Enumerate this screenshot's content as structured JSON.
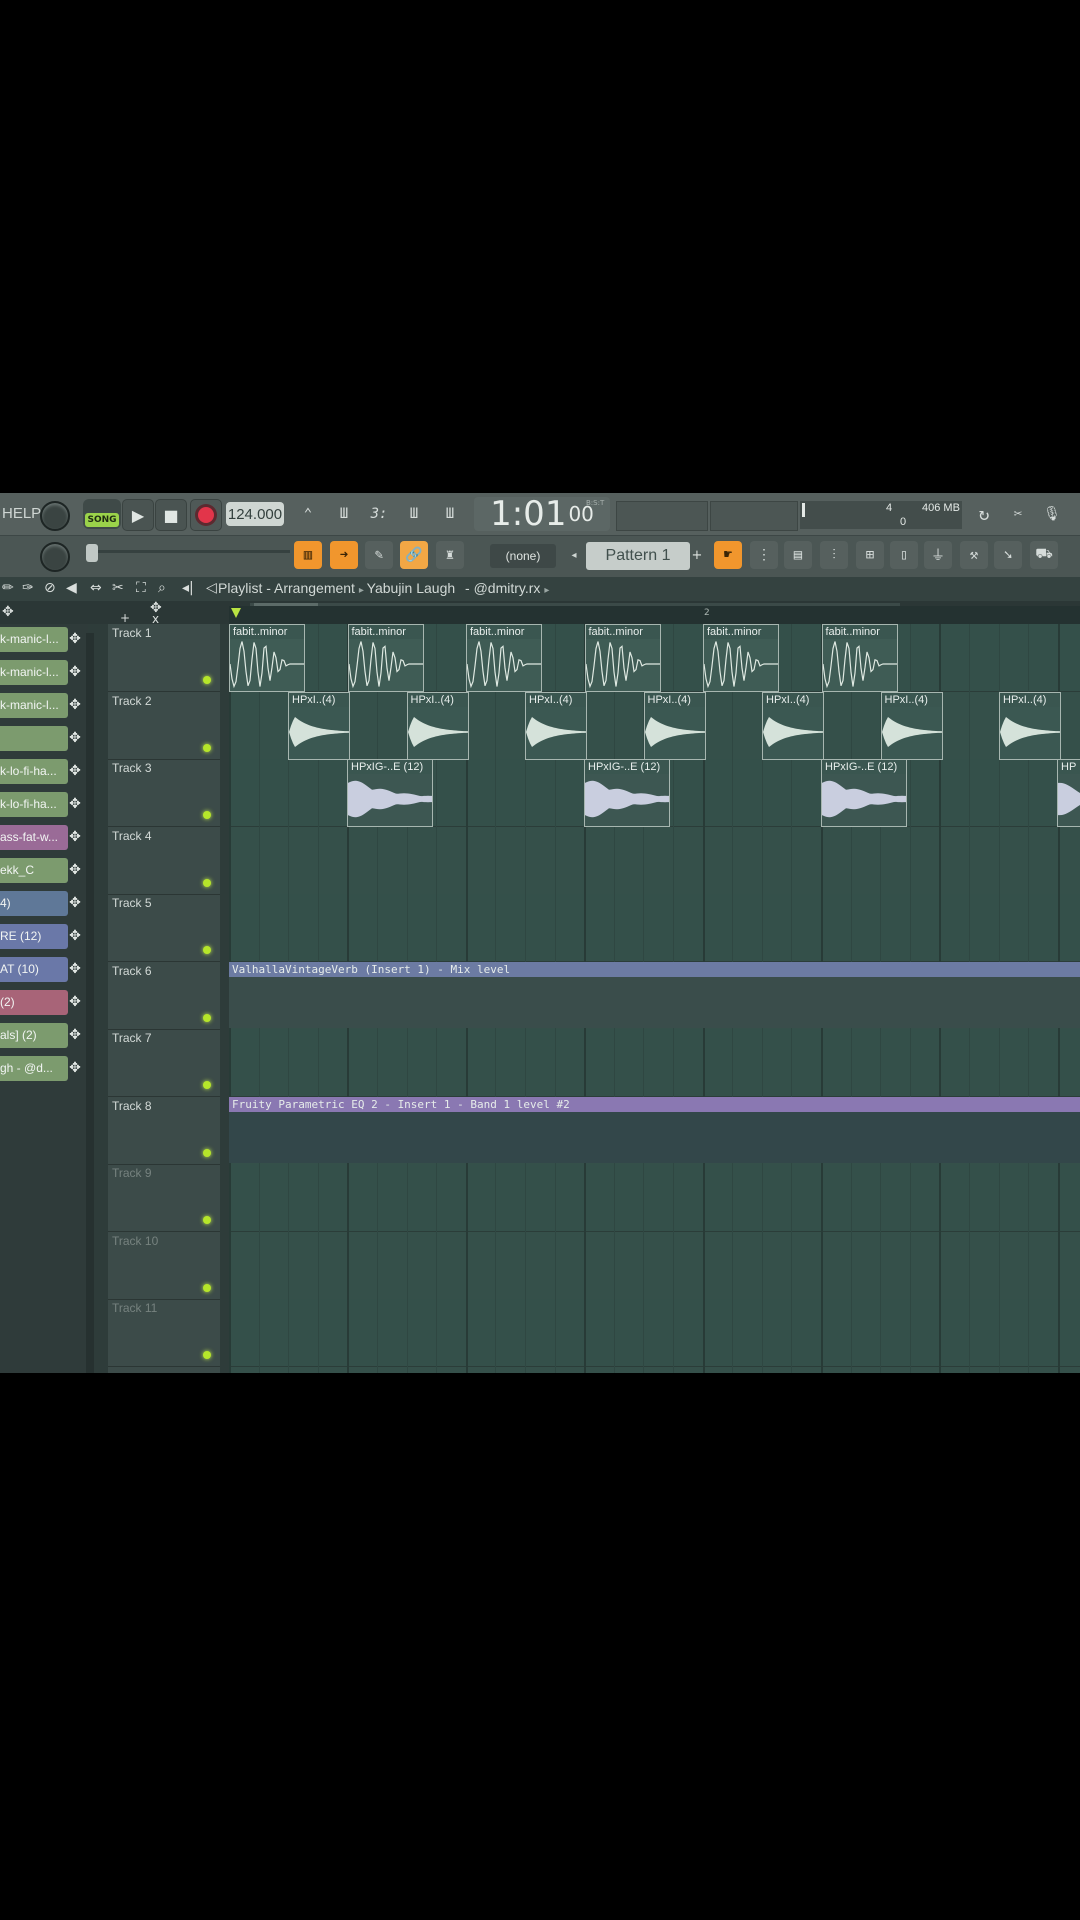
{
  "toolbar": {
    "help_label": "HELP",
    "song_label": "SONG",
    "tempo": "124.000",
    "time_main": "1:01",
    "time_sub": "00",
    "time_unit": "B:S:T",
    "cpu_value": "4",
    "memory": "406 MB",
    "poly": "0",
    "dropdown_none": "(none)",
    "pattern": "Pattern 1"
  },
  "playlist": {
    "title": "Playlist - Arrangement",
    "crumb_song": "Yabujin Laugh",
    "crumb_user": "- @dmitry.rx",
    "ruler_marks": [
      "2"
    ]
  },
  "channels": [
    {
      "label": "k-manic-l...",
      "color": "#7c9b6e"
    },
    {
      "label": "k-manic-l...",
      "color": "#7c9b6e"
    },
    {
      "label": "k-manic-l...",
      "color": "#7c9b6e"
    },
    {
      "label": "",
      "color": "#7c9b6e"
    },
    {
      "label": "k-lo-fi-ha...",
      "color": "#7c9b6e"
    },
    {
      "label": "k-lo-fi-ha...",
      "color": "#7c9b6e"
    },
    {
      "label": "ass-fat-w...",
      "color": "#9a6b97"
    },
    {
      "label": "ekk_C",
      "color": "#7c9b6e"
    },
    {
      "label": "4)",
      "color": "#5f7898"
    },
    {
      "label": "RE (12)",
      "color": "#6a78a8"
    },
    {
      "label": "AT (10)",
      "color": "#6a78a8"
    },
    {
      "label": "(2)",
      "color": "#a86478"
    },
    {
      "label": "als] (2)",
      "color": "#7c9b6e"
    },
    {
      "label": "gh - @d...",
      "color": "#7c9b6e"
    }
  ],
  "tracks": [
    {
      "label": "Track 1"
    },
    {
      "label": "Track 2"
    },
    {
      "label": "Track 3"
    },
    {
      "label": "Track 4"
    },
    {
      "label": "Track 5"
    },
    {
      "label": "Track 6"
    },
    {
      "label": "Track 7"
    },
    {
      "label": "Track 8"
    },
    {
      "label": "Track 9"
    },
    {
      "label": "Track 10"
    },
    {
      "label": "Track 11"
    }
  ],
  "clips": {
    "track1": "fabit..minor",
    "track2": "HPxI..(4)",
    "track3": "HPxIG-..E (12)",
    "track3_partial": "HP"
  },
  "automation": {
    "track6": "ValhallaVintageVerb (Insert 1) - Mix level",
    "track6_color": "#6c7ba3",
    "track8": "Fruity Parametric EQ 2 - Insert 1 - Band 1 level #2",
    "track8_color": "#8a78b2"
  }
}
